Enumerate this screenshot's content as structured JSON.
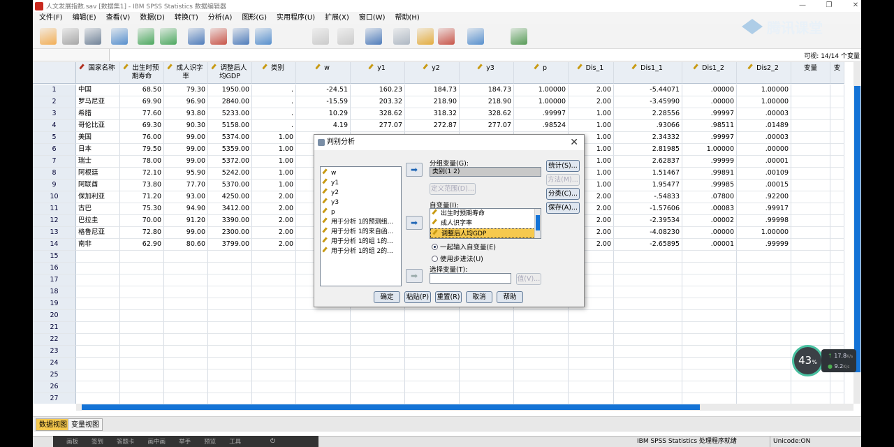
{
  "window": {
    "title": "人文发展指数.sav [数据集1] - IBM SPSS Statistics 数据编辑器",
    "controls": [
      "—",
      "❐",
      "✕"
    ]
  },
  "menu": [
    "文件(F)",
    "编辑(E)",
    "查看(V)",
    "数据(D)",
    "转换(T)",
    "分析(A)",
    "图形(G)",
    "实用程序(U)",
    "扩展(X)",
    "窗口(W)",
    "帮助(H)"
  ],
  "toolbar_icons": [
    "open-icon",
    "save-icon",
    "print-icon",
    "dialog-recall-icon",
    "undo-icon",
    "redo-icon",
    "goto-case-icon",
    "goto-variable-icon",
    "variables-icon",
    "run-descriptives-icon",
    "find-icon",
    "insert-cases-icon",
    "insert-variable-icon",
    "split-file-icon",
    "weight-cases-icon",
    "select-cases-icon",
    "value-labels-icon",
    "use-sets-icon",
    "show-all-icon",
    "spell-check-icon"
  ],
  "watermark": "腾讯课堂",
  "visible_label": "可视: 14/14 个变量",
  "columns": [
    {
      "name": "国家名称",
      "icon": "nominal-icon"
    },
    {
      "name": "出生时预期寿命",
      "icon": "scale-icon"
    },
    {
      "name": "成人识字率",
      "icon": "scale-icon"
    },
    {
      "name": "调整后人均GDP",
      "icon": "scale-icon"
    },
    {
      "name": "类别",
      "icon": "scale-icon"
    },
    {
      "name": "w",
      "icon": "scale-icon"
    },
    {
      "name": "y1",
      "icon": "scale-icon"
    },
    {
      "name": "y2",
      "icon": "scale-icon"
    },
    {
      "name": "y3",
      "icon": "scale-icon"
    },
    {
      "name": "p",
      "icon": "scale-icon"
    },
    {
      "name": "Dis_1",
      "icon": "scale-icon"
    },
    {
      "name": "Dis1_1",
      "icon": "scale-icon"
    },
    {
      "name": "Dis1_2",
      "icon": "scale-icon"
    },
    {
      "name": "Dis2_2",
      "icon": "scale-icon"
    },
    {
      "name": "变量",
      "icon": ""
    },
    {
      "name": "变",
      "icon": ""
    }
  ],
  "rows": [
    [
      "1",
      "中国",
      "68.50",
      "79.30",
      "1950.00",
      ".",
      "-24.51",
      "160.23",
      "184.73",
      "184.73",
      "1.00000",
      "2.00",
      "-5.44071",
      ".00000",
      "1.00000"
    ],
    [
      "2",
      "罗马尼亚",
      "69.90",
      "96.90",
      "2840.00",
      ".",
      "-15.59",
      "203.32",
      "218.90",
      "218.90",
      "1.00000",
      "2.00",
      "-3.45990",
      ".00000",
      "1.00000"
    ],
    [
      "3",
      "希腊",
      "77.60",
      "93.80",
      "5233.00",
      ".",
      "10.29",
      "328.62",
      "318.32",
      "328.62",
      ".99997",
      "1.00",
      "2.28556",
      ".99997",
      ".00003"
    ],
    [
      "4",
      "哥伦比亚",
      "69.30",
      "90.30",
      "5158.00",
      ".",
      "4.19",
      "277.07",
      "272.87",
      "277.07",
      ".98524",
      "1.00",
      ".93066",
      ".98511",
      ".01489"
    ],
    [
      "5",
      "美国",
      "76.00",
      "99.00",
      "5374.00",
      "1.00",
      "",
      "",
      "",
      "",
      "",
      "1.00",
      "2.34332",
      ".99997",
      ".00003"
    ],
    [
      "6",
      "日本",
      "79.50",
      "99.00",
      "5359.00",
      "1.00",
      "",
      "",
      "",
      "",
      "",
      "1.00",
      "2.81985",
      "1.00000",
      ".00000"
    ],
    [
      "7",
      "瑞士",
      "78.00",
      "99.00",
      "5372.00",
      "1.00",
      "",
      "",
      "",
      "",
      "",
      "1.00",
      "2.62837",
      ".99999",
      ".00001"
    ],
    [
      "8",
      "阿根廷",
      "72.10",
      "95.90",
      "5242.00",
      "1.00",
      "",
      "",
      "",
      "",
      "",
      "1.00",
      "1.51467",
      ".99891",
      ".00109"
    ],
    [
      "9",
      "阿联酋",
      "73.80",
      "77.70",
      "5370.00",
      "1.00",
      "",
      "",
      "",
      "",
      "",
      "1.00",
      "1.95477",
      ".99985",
      ".00015"
    ],
    [
      "10",
      "保加利亚",
      "71.20",
      "93.00",
      "4250.00",
      "2.00",
      "",
      "",
      "",
      "",
      "",
      "2.00",
      "-.54833",
      ".07800",
      ".92200"
    ],
    [
      "11",
      "古巴",
      "75.30",
      "94.90",
      "3412.00",
      "2.00",
      "",
      "",
      "",
      "",
      "",
      "2.00",
      "-1.57606",
      ".00083",
      ".99917"
    ],
    [
      "12",
      "巴拉圭",
      "70.00",
      "91.20",
      "3390.00",
      "2.00",
      "",
      "",
      "",
      "",
      "",
      "2.00",
      "-2.39534",
      ".00002",
      ".99998"
    ],
    [
      "13",
      "格鲁尼亚",
      "72.80",
      "99.00",
      "2300.00",
      "2.00",
      "",
      "",
      "",
      "",
      "",
      "2.00",
      "-4.08230",
      ".00000",
      "1.00000"
    ],
    [
      "14",
      "南非",
      "62.90",
      "80.60",
      "3799.00",
      "2.00",
      "",
      "",
      "",
      "",
      "",
      "2.00",
      "-2.65895",
      ".00001",
      ".99999"
    ],
    [
      "15"
    ],
    [
      "16"
    ],
    [
      "17"
    ],
    [
      "18"
    ],
    [
      "19"
    ],
    [
      "20"
    ],
    [
      "21"
    ],
    [
      "22"
    ],
    [
      "23"
    ],
    [
      "24"
    ],
    [
      "25"
    ],
    [
      "26"
    ],
    [
      "27"
    ]
  ],
  "tabs": {
    "data_view": "数据视图",
    "variable_view": "变量视图"
  },
  "status": {
    "processor": "IBM SPSS Statistics 处理程序就绪",
    "unicode": "Unicode:ON"
  },
  "overlay_bar": [
    "画板",
    "签到",
    "答题卡",
    "画中画",
    "举手",
    "预览",
    "工具"
  ],
  "speed": {
    "percent": "43",
    "pct_sign": "%",
    "up": "17.8",
    "up_unit": "K/s",
    "down": "9.2",
    "down_unit": "K/s"
  },
  "dialog": {
    "title": "判别分析",
    "source_list": [
      "w",
      "y1",
      "y2",
      "y3",
      "p",
      "用于分析 1的预测组...",
      "用于分析 1的来自函...",
      "用于分析 1的组 1的...",
      "用于分析 1的组 2的..."
    ],
    "grouping_label": "分组变量(G):",
    "grouping_value": "类别(1 2)",
    "define_range": "定义范围(D)...",
    "independents_label": "自变量(I):",
    "independents": [
      "出生时预期寿命",
      "成人识字率",
      "调整后人均GDP"
    ],
    "radio_together": "一起输入自变量(E)",
    "radio_stepwise": "使用步进法(U)",
    "selection_label": "选择变量(T):",
    "value_button": "值(V)...",
    "side_buttons": {
      "statistics": "统计(S)...",
      "method": "方法(M)...",
      "classify": "分类(C)...",
      "save": "保存(A)..."
    },
    "bottom_buttons": {
      "ok": "确定",
      "paste": "粘贴(P)",
      "reset": "重置(R)",
      "cancel": "取消",
      "help": "帮助"
    }
  }
}
